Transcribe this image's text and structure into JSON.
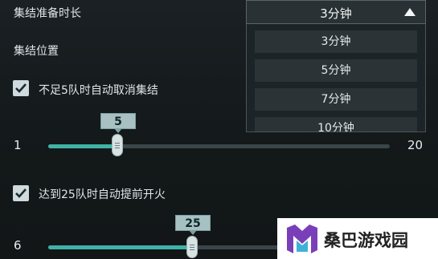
{
  "settings": {
    "rally_duration_label": "集结准备时长",
    "rally_position_label": "集结位置",
    "auto_cancel": {
      "checked": true,
      "label": "不足5队时自动取消集结",
      "slider": {
        "min_label": "1",
        "max_label": "20",
        "value_label": "5",
        "min": 1,
        "max": 20,
        "value": 5
      }
    },
    "auto_start": {
      "checked": true,
      "label": "达到25队时自动提前开火",
      "slider": {
        "min_label": "6",
        "value_label": "25",
        "min": 6,
        "max": 50,
        "value": 25
      }
    }
  },
  "dropdown": {
    "selected": "3分钟",
    "options": [
      "3分钟",
      "5分钟",
      "7分钟",
      "10分钟"
    ]
  },
  "watermark": {
    "text": "桑巴游戏园"
  },
  "colors": {
    "accent": "#3fb3a6",
    "panel": "#14191c"
  }
}
